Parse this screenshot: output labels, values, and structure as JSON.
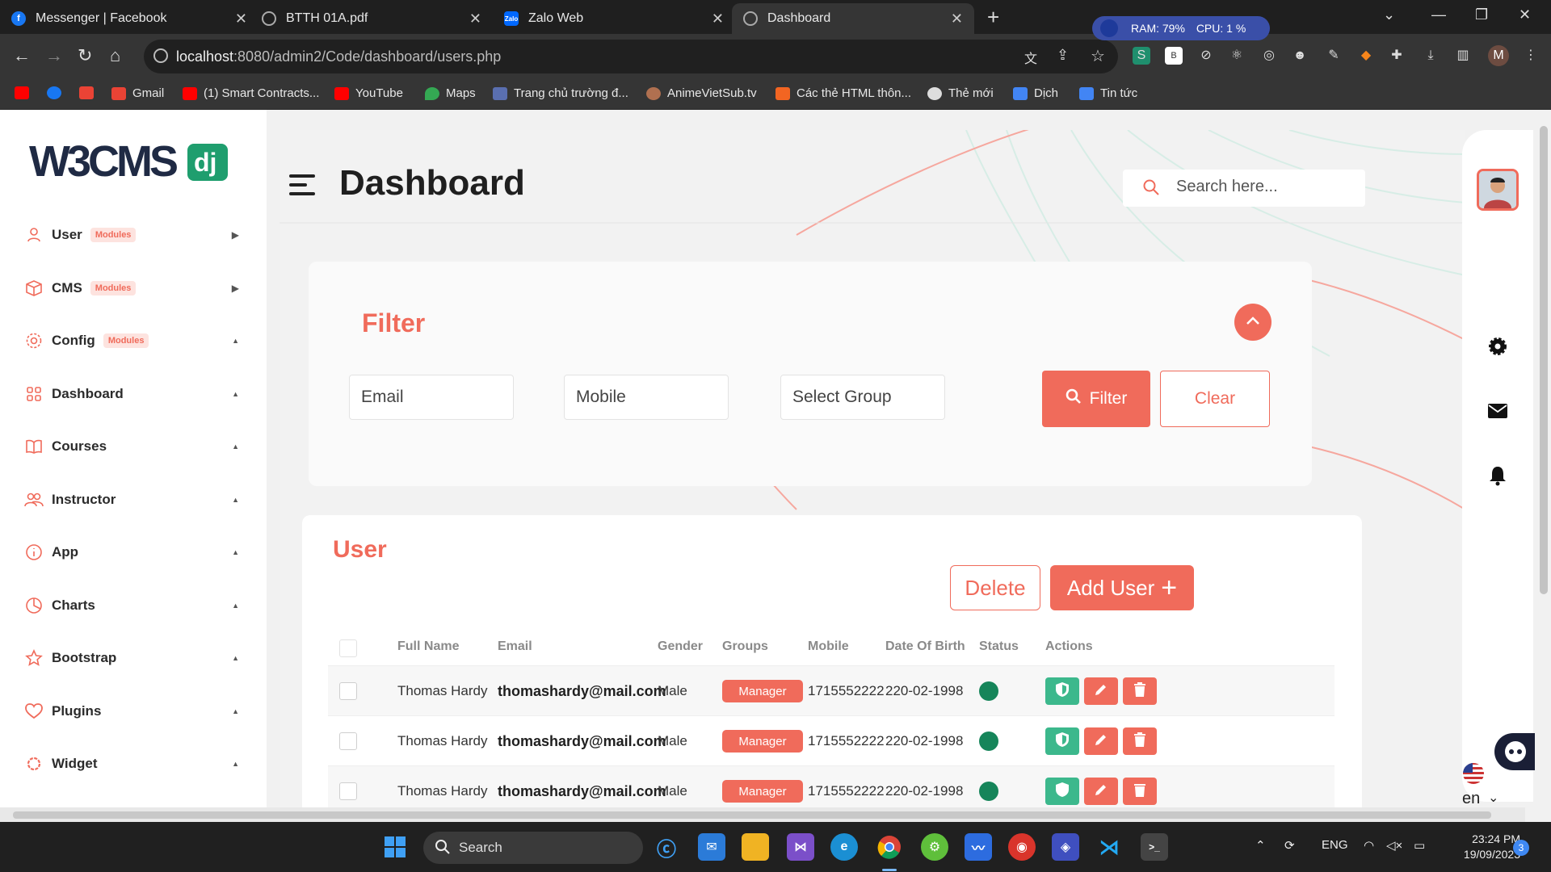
{
  "browser": {
    "tabs": [
      {
        "title": "Messenger | Facebook",
        "color": "#1877f2"
      },
      {
        "title": "BTTH 01A.pdf",
        "color": "#888888"
      },
      {
        "title": "Zalo Web",
        "color": "#0068ff"
      },
      {
        "title": "Dashboard",
        "color": "#888888"
      }
    ],
    "url_host": "localhost",
    "url_path": ":8080/admin2/Code/dashboard/users.php",
    "ram": "RAM: 79%",
    "cpu": "CPU: 1 %",
    "profile_initial": "M",
    "bookmarks": [
      {
        "label": "",
        "color": "#ff0000"
      },
      {
        "label": "",
        "color": "#1877f2"
      },
      {
        "label": "",
        "color": "#ea4335"
      },
      {
        "label": "Gmail",
        "color": "#ea4335"
      },
      {
        "label": "(1) Smart Contracts...",
        "color": "#ff0000"
      },
      {
        "label": "YouTube",
        "color": "#ff0000"
      },
      {
        "label": "Maps",
        "color": "#34a853"
      },
      {
        "label": "Trang chủ trường đ...",
        "color": "#5a6fb0"
      },
      {
        "label": "AnimeVietSub.tv",
        "color": "#b07050"
      },
      {
        "label": "Các thẻ HTML thôn...",
        "color": "#f26522"
      },
      {
        "label": "Thẻ mới",
        "color": "#dddddd"
      },
      {
        "label": "Dịch",
        "color": "#4285f4"
      },
      {
        "label": "Tin tức",
        "color": "#4285f4"
      }
    ]
  },
  "logo": {
    "text": "W3CMS",
    "badge": "dj"
  },
  "sidebar": {
    "items": [
      {
        "label": "User",
        "badge": "Modules",
        "icon": "user-icon"
      },
      {
        "label": "CMS",
        "badge": "Modules",
        "icon": "box-icon"
      },
      {
        "label": "Config",
        "badge": "Modules",
        "icon": "gear-icon"
      },
      {
        "label": "Dashboard",
        "badge": "",
        "icon": "grid-icon"
      },
      {
        "label": "Courses",
        "badge": "",
        "icon": "book-icon"
      },
      {
        "label": "Instructor",
        "badge": "",
        "icon": "users-icon"
      },
      {
        "label": "App",
        "badge": "",
        "icon": "info-icon"
      },
      {
        "label": "Charts",
        "badge": "",
        "icon": "pie-chart-icon"
      },
      {
        "label": "Bootstrap",
        "badge": "",
        "icon": "star-icon"
      },
      {
        "label": "Plugins",
        "badge": "",
        "icon": "heart-icon"
      },
      {
        "label": "Widget",
        "badge": "",
        "icon": "settings-icon"
      }
    ]
  },
  "header": {
    "title": "Dashboard",
    "search_placeholder": "Search here..."
  },
  "filter": {
    "title": "Filter",
    "email_placeholder": "Email",
    "mobile_placeholder": "Mobile",
    "group_placeholder": "Select Group",
    "filter_label": "Filter",
    "clear_label": "Clear"
  },
  "users": {
    "title": "User",
    "delete_label": "Delete",
    "add_label": "Add User",
    "columns": [
      "Full Name",
      "Email",
      "Gender",
      "Groups",
      "Mobile",
      "Date Of Birth",
      "Status",
      "Actions"
    ],
    "rows": [
      {
        "name": "Thomas Hardy",
        "email": "thomashardy@mail.com",
        "gender": "Male",
        "group": "Manager",
        "mobile": "1715552222",
        "dob": "220-02-1998",
        "status": "active"
      },
      {
        "name": "Thomas Hardy",
        "email": "thomashardy@mail.com",
        "gender": "Male",
        "group": "Manager",
        "mobile": "1715552222",
        "dob": "220-02-1998",
        "status": "active"
      },
      {
        "name": "Thomas Hardy",
        "email": "thomashardy@mail.com",
        "gender": "Male",
        "group": "Manager",
        "mobile": "1715552222",
        "dob": "220-02-1998",
        "status": "active"
      }
    ]
  },
  "language": {
    "code": "en"
  },
  "taskbar": {
    "search_label": "Search",
    "lang": "ENG",
    "time": "23:24 PM",
    "date": "19/09/2023",
    "notifications": "3"
  },
  "colors": {
    "accent": "#f06b5b",
    "status_active": "#16855a",
    "action_green": "#3cb88c"
  }
}
